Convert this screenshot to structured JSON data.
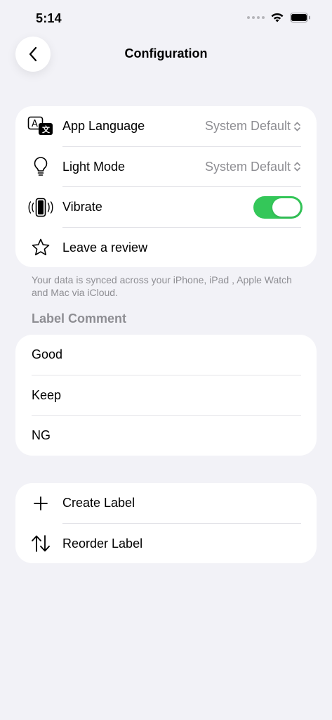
{
  "status_bar": {
    "time": "5:14"
  },
  "nav": {
    "title": "Configuration"
  },
  "settings": {
    "items": [
      {
        "label": "App Language",
        "value": "System Default"
      },
      {
        "label": "Light Mode",
        "value": "System Default"
      },
      {
        "label": "Vibrate",
        "toggle_on": true
      },
      {
        "label": "Leave a review"
      }
    ],
    "footnote": "Your data is synced across your iPhone, iPad , Apple Watch and Mac via iCloud."
  },
  "labels_section": {
    "header": "Label Comment",
    "items": [
      "Good",
      "Keep",
      "NG"
    ]
  },
  "actions": {
    "items": [
      {
        "label": "Create Label"
      },
      {
        "label": "Reorder Label"
      }
    ]
  },
  "colors": {
    "accent_toggle": "#34c759",
    "background": "#f2f2f7"
  }
}
